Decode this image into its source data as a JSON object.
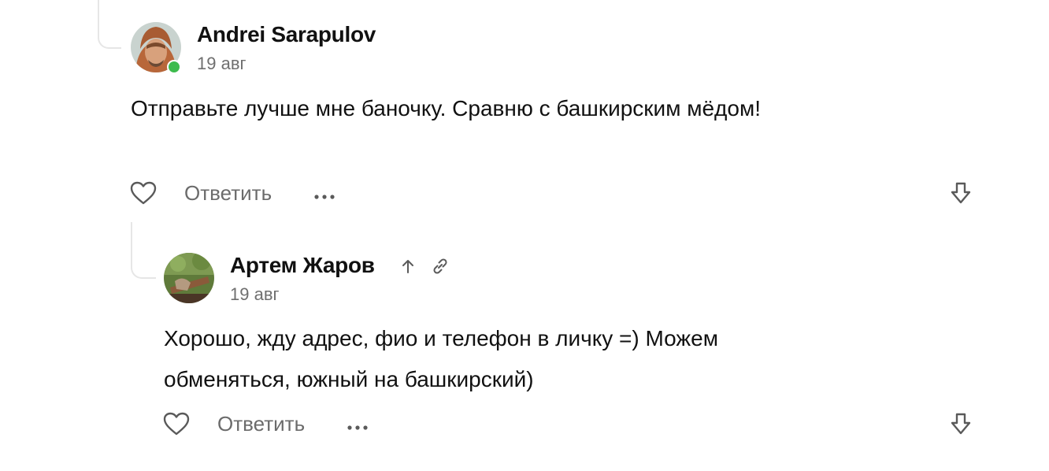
{
  "comments": [
    {
      "author": "Andrei Sarapulov",
      "date": "19 авг",
      "online": true,
      "text": "Отправьте лучше мне баночку. Сравню с башкирским мёдом!",
      "reply_label": "Ответить",
      "more_label": "···"
    },
    {
      "author": "Артем Жаров",
      "date": "19 авг",
      "icons": [
        "arrow-up-icon",
        "link-icon"
      ],
      "text": "Хорошо, жду адрес, фио и телефон в личку =) Можем обменяться, южный на башкирский)",
      "reply_label": "Ответить",
      "more_label": "···"
    }
  ],
  "colors": {
    "online": "#3dbb4d",
    "muted_text": "#6b6b6b",
    "thread_line": "#e6e6e6"
  }
}
